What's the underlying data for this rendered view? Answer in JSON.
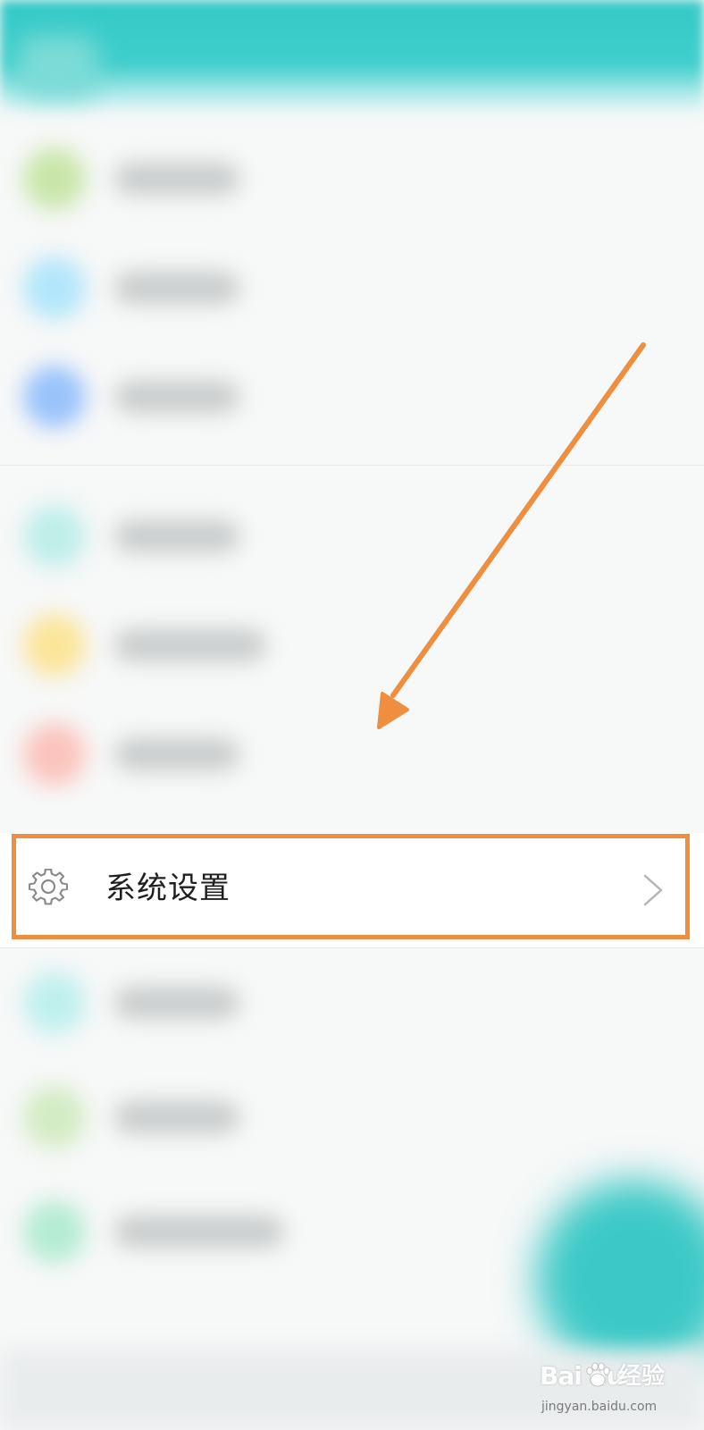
{
  "settings_row": {
    "label": "系统设置",
    "icon": "gear-icon",
    "chevron_icon": "chevron-right-icon"
  },
  "blurred_rows": [
    {
      "icon_color": "#c9e6a9"
    },
    {
      "icon_color": "#b3e6fb"
    },
    {
      "icon_color": "#99c3fb"
    },
    {
      "icon_color": "#bfeee9"
    },
    {
      "icon_color": "#fbe59a"
    },
    {
      "icon_color": "#fbc4bd"
    },
    {
      "icon_color": "#bff0ee"
    },
    {
      "icon_color": "#d3ecc4"
    },
    {
      "icon_color": "#b5ecd3"
    }
  ],
  "annotation": {
    "color": "#ef8e3f"
  },
  "theme": {
    "header_color": "#34c9c6",
    "fab_color": "#3cc9c6"
  },
  "watermark": {
    "brand": "Bai du",
    "product": "经验",
    "url": "jingyan.baidu.com"
  }
}
